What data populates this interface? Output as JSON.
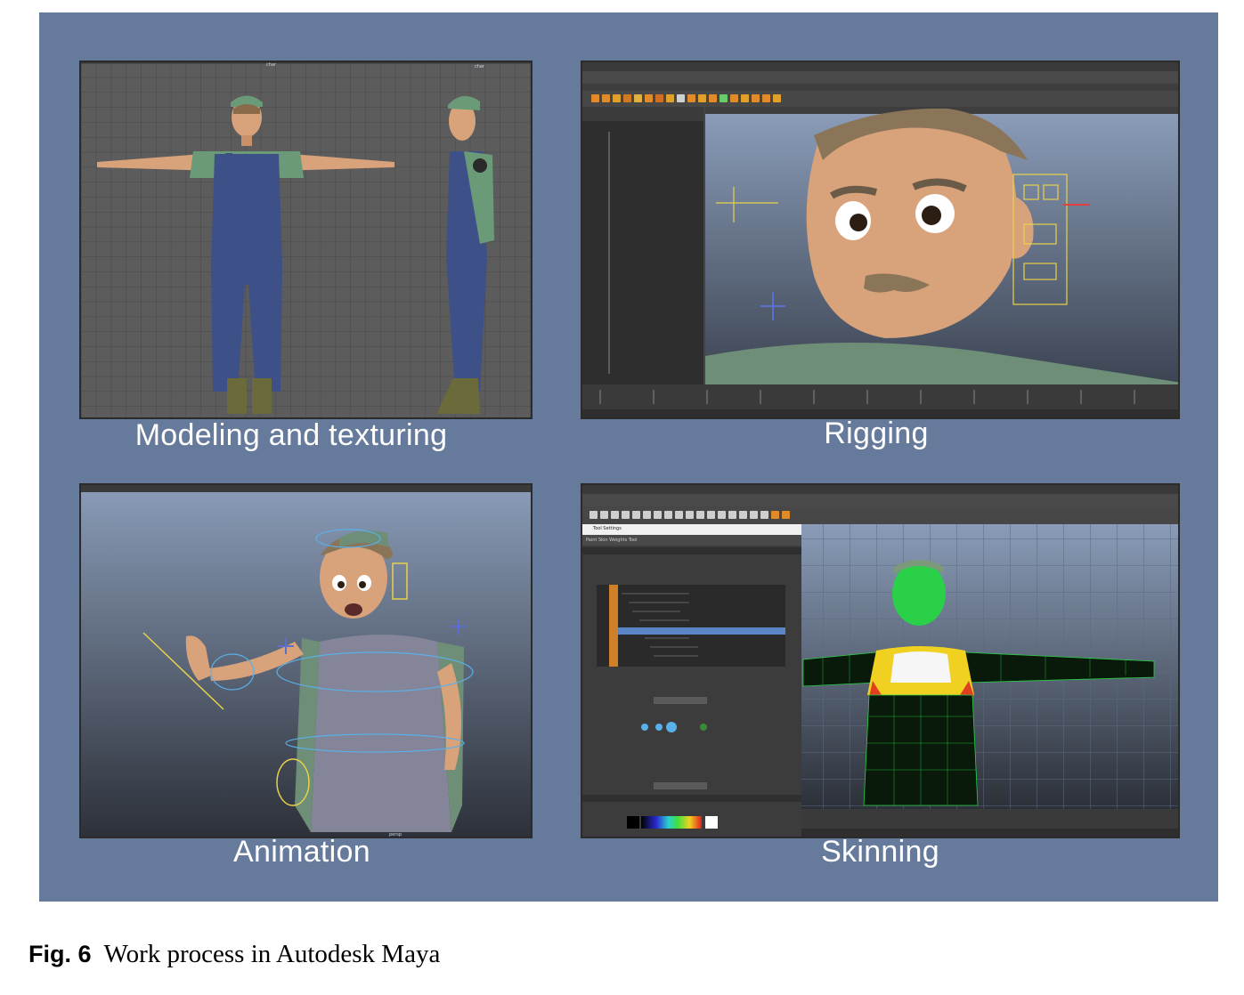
{
  "panels": [
    {
      "id": "modeling",
      "caption": "Modeling and texturing",
      "viewport_labels": [
        "char",
        "char"
      ]
    },
    {
      "id": "rigging",
      "caption": "Rigging"
    },
    {
      "id": "animation",
      "caption": "Animation",
      "viewport_labels": [
        "persp"
      ]
    },
    {
      "id": "skinning",
      "caption": "Skinning",
      "tool_window_title": "Tool Settings",
      "tool_name": "Paint Skin Weights Tool"
    }
  ],
  "figure_caption": {
    "label": "Fig. 6",
    "text": "Work process in Autodesk Maya"
  },
  "colors": {
    "panel_bg": "#667a9c",
    "viewport_grid": "#5a5a5a",
    "maya_ui": "#444444",
    "viewport_gradient_top": "#8a9cb8",
    "viewport_gradient_bottom": "#2c3038"
  }
}
